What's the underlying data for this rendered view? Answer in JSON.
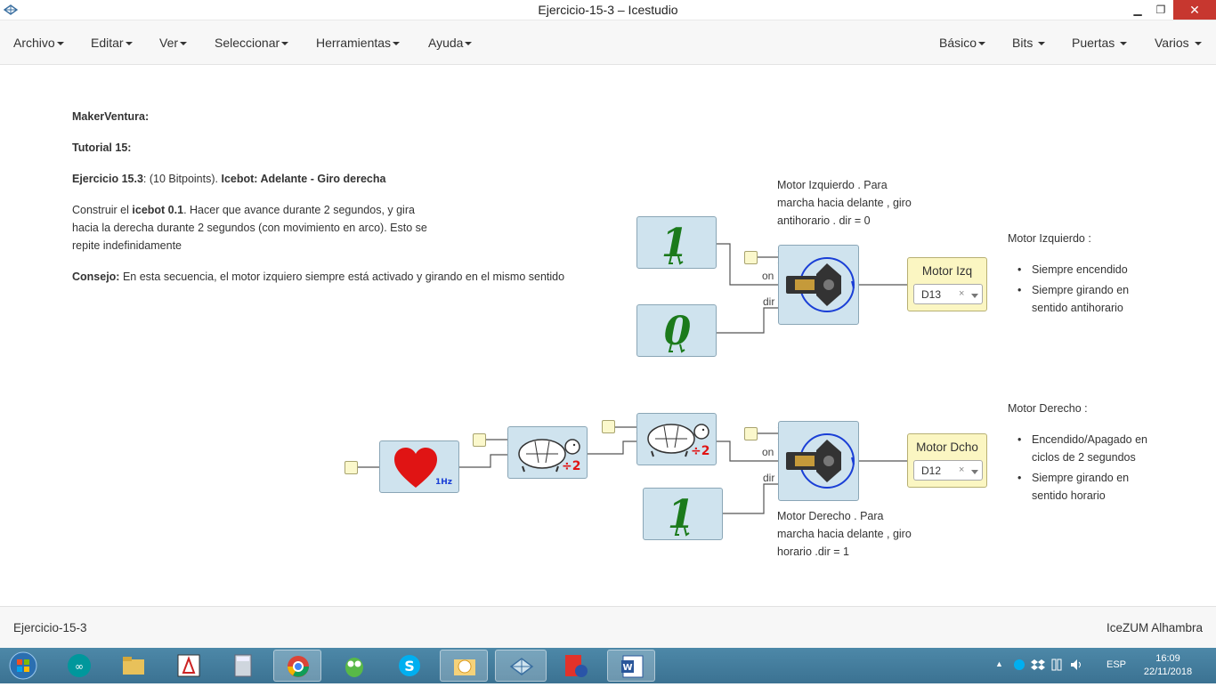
{
  "window": {
    "title": "Ejercicio-15-3 – Icestudio",
    "minimize": "▁",
    "maximize": "❐",
    "close": "✕"
  },
  "menu": {
    "left": [
      "Archivo",
      "Editar",
      "Ver",
      "Seleccionar",
      "Herramientas",
      "Ayuda"
    ],
    "right": [
      "Básico",
      "Bits",
      "Puertas",
      "Varios"
    ]
  },
  "notes": {
    "line1": "MakerVentura:",
    "line2": "Tutorial 15:",
    "exercise_bold": "Ejercicio 15.3",
    "exercise_points": ": (10 Bitpoints). ",
    "exercise_title": "Icebot: Adelante - Giro derecha",
    "desc_a": "Construir el ",
    "desc_b": "icebot 0.1",
    "desc_c": ". Hacer que avance durante 2 segundos, y gira",
    "desc_d": "hacia la derecha durante 2 segundos (con movimiento en arco). Esto se",
    "desc_e": "repite indefinidamente",
    "tip_bold": "Consejo:",
    "tip_text": " En esta secuencia, el motor izquiero siempre está activado y girando en el mismo sentido"
  },
  "circuit": {
    "const_one": "1",
    "const_zero": "0",
    "const_one_b": "1",
    "port_on": "on",
    "port_dir": "dir",
    "port_on_b": "on",
    "port_dir_b": "dir",
    "heart_freq": "1Hz",
    "div_label": "÷2",
    "div_label_b": "÷2",
    "motor_left_comment_1": "Motor Izquierdo . Para",
    "motor_left_comment_2": "marcha hacia delante , giro",
    "motor_left_comment_3": "antihorario . dir = 0",
    "motor_right_comment_1": "Motor Derecho . Para",
    "motor_right_comment_2": "marcha hacia delante , giro",
    "motor_right_comment_3": "horario .dir = 1",
    "out_left_name": "Motor Izq",
    "out_left_pin": "D13",
    "out_right_name": "Motor Dcho",
    "out_right_pin": "D12",
    "clear_mark": "×"
  },
  "side": {
    "left_title": "Motor Izquierdo :",
    "left_items": [
      "Siempre encendido",
      "Siempre girando en sentido antihorario"
    ],
    "right_title": "Motor Derecho :",
    "right_items": [
      "Encendido/Apagado en ciclos de 2 segundos",
      "Siempre girando en sentido horario"
    ]
  },
  "status": {
    "left": "Ejercicio-15-3",
    "right": "IceZUM Alhambra"
  },
  "taskbar": {
    "apps": [
      "start-orb",
      "arduino-icon",
      "file-explorer-icon",
      "drawing-app-icon",
      "calculator-icon",
      "chrome-icon",
      "owl-app-icon",
      "skype-icon",
      "outlook-icon",
      "icestudio-icon",
      "fritzing-icon",
      "word-icon"
    ],
    "lang": "ESP",
    "time": "16:09",
    "date": "22/11/2018"
  },
  "colors": {
    "block_fill": "#cfe3ee",
    "port_fill": "#fbf8cc",
    "output_fill": "#fbf6c2",
    "constant_green": "#1b7a1b",
    "heart_red": "#e01414",
    "close_red": "#c7372f"
  }
}
